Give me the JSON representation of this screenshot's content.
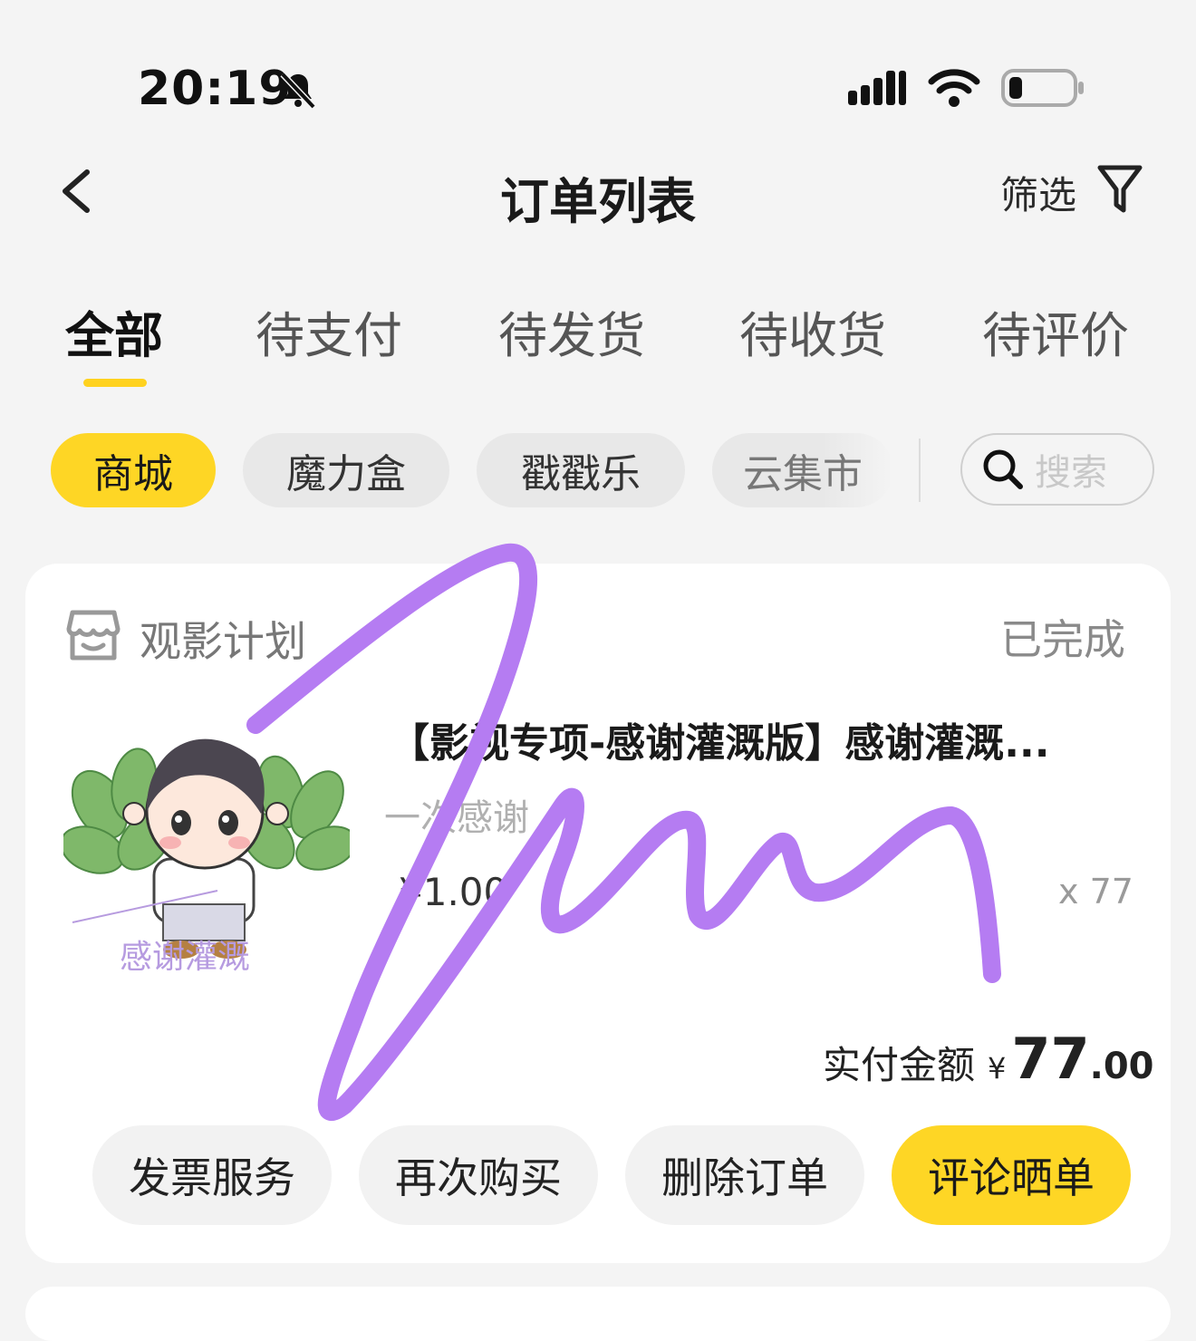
{
  "status_bar": {
    "time": "20:19"
  },
  "nav": {
    "title": "订单列表",
    "filter_label": "筛选"
  },
  "tabs": [
    {
      "label": "全部",
      "active": true
    },
    {
      "label": "待支付"
    },
    {
      "label": "待发货"
    },
    {
      "label": "待收货"
    },
    {
      "label": "待评价"
    }
  ],
  "chips": [
    {
      "label": "商城",
      "active": true
    },
    {
      "label": "魔力盒"
    },
    {
      "label": "戳戳乐"
    },
    {
      "label": "云集市"
    }
  ],
  "search": {
    "placeholder": "搜索"
  },
  "order": {
    "store_name": "观影计划",
    "status": "已完成",
    "product_title": "【影视专项-感谢灌溉版】感谢灌溉...",
    "spec": "一次感谢",
    "unit_price": "¥1.00",
    "quantity": "x 77",
    "paid_label": "实付金额",
    "paid_currency": "¥",
    "paid_int": "77",
    "paid_dec": ".00",
    "thumb_text": "感谢灌溉",
    "buttons": [
      "发票服务",
      "再次购买",
      "删除订单",
      "评论晒单"
    ]
  },
  "colors": {
    "accent": "#fed625",
    "scribble": "#b57cf2"
  }
}
